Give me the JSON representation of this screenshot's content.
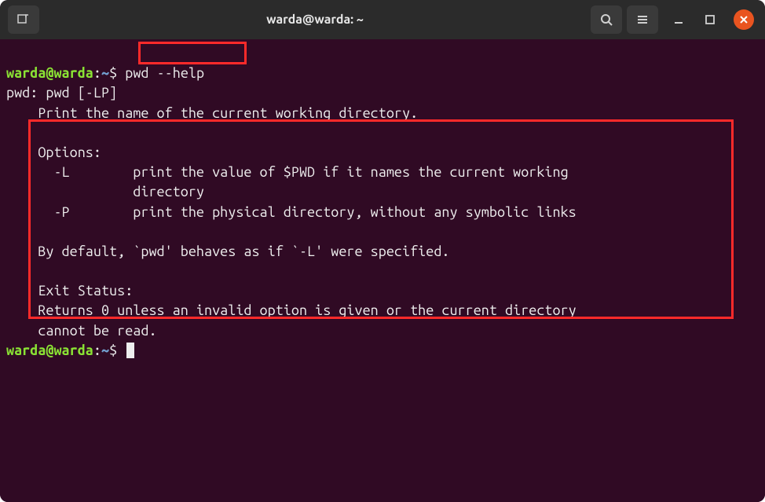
{
  "titlebar": {
    "title": "warda@warda: ~"
  },
  "prompt1": {
    "user_host": "warda@warda",
    "separator": ":",
    "path": "~",
    "sigil": "$",
    "command": "pwd --help"
  },
  "output": {
    "usage": "pwd: pwd [-LP]",
    "desc": "    Print the name of the current working directory.",
    "blank1": "    ",
    "options_hdr": "    Options:",
    "opt_l_1": "      -L        print the value of $PWD if it names the current working",
    "opt_l_2": "                directory",
    "opt_p": "      -P        print the physical directory, without any symbolic links",
    "blank2": "    ",
    "default": "    By default, `pwd' behaves as if `-L' were specified.",
    "blank3": "    ",
    "exit_hdr": "    Exit Status:",
    "exit_1": "    Returns 0 unless an invalid option is given or the current directory",
    "exit_2": "    cannot be read."
  },
  "prompt2": {
    "user_host": "warda@warda",
    "separator": ":",
    "path": "~",
    "sigil": "$"
  }
}
